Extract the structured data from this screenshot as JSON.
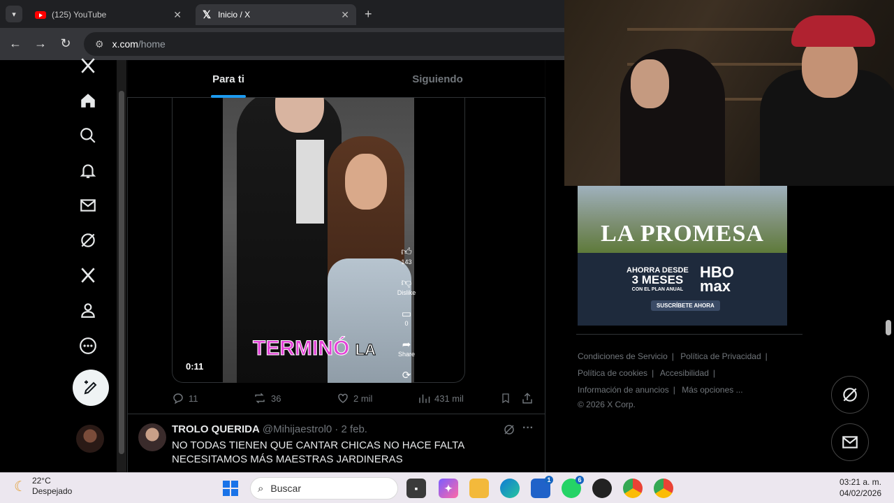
{
  "browser": {
    "tabs": [
      {
        "title": "(125) YouTube"
      },
      {
        "title": "Inicio / X"
      }
    ],
    "url_host": "x.com",
    "url_path": "/home"
  },
  "x": {
    "feed_tabs": [
      "Para ti",
      "Siguiendo"
    ],
    "left_nav_icons": [
      "x-logo-icon",
      "home-icon",
      "search-icon",
      "bell-icon",
      "mail-icon",
      "grok-icon",
      "x-premium-icon",
      "profile-icon",
      "more-icon"
    ],
    "video": {
      "timestamp": "0:11",
      "caption_pink": "TERMINÓ",
      "caption_white": "LA",
      "side_actions": [
        {
          "icon": "thumbs-up-icon",
          "label": "143"
        },
        {
          "icon": "thumbs-down-icon",
          "label": "Dislike"
        },
        {
          "icon": "comment-icon",
          "label": "0"
        },
        {
          "icon": "share-icon",
          "label": "Share"
        }
      ]
    },
    "actions": {
      "replies": "11",
      "reposts": "36",
      "likes": "2 mil",
      "views": "431 mil"
    },
    "tweet2": {
      "name": "TROLO QUERIDA",
      "handle": "@Mihijaestrol0",
      "date": "· 2 feb.",
      "text": "NO TODAS TIENEN QUE CANTAR CHICAS NO HACE FALTA NECESITAMOS MÁS MAESTRAS JARDINERAS"
    },
    "ad": {
      "title": "LA PROMESA",
      "promo_line1": "AHORRA DESDE",
      "promo_big": "3 MESES",
      "promo_line3": "CON EL PLAN ANUAL",
      "brand_line1": "HBO",
      "brand_line2": "max",
      "cta": "SUSCRÍBETE AHORA"
    },
    "footer": {
      "terms": "Condiciones de Servicio",
      "privacy": "Política de Privacidad",
      "cookies": "Política de cookies",
      "accessibility": "Accesibilidad",
      "ads_info": "Información de anuncios",
      "more": "Más opciones ...",
      "copyright": "© 2026 X Corp."
    }
  },
  "taskbar": {
    "weather_temp": "22°C",
    "weather_desc": "Despejado",
    "search_placeholder": "Buscar",
    "time": "03:21 a. m.",
    "date": "04/02/2026",
    "badges": {
      "store": "1",
      "whatsapp": "6"
    }
  }
}
